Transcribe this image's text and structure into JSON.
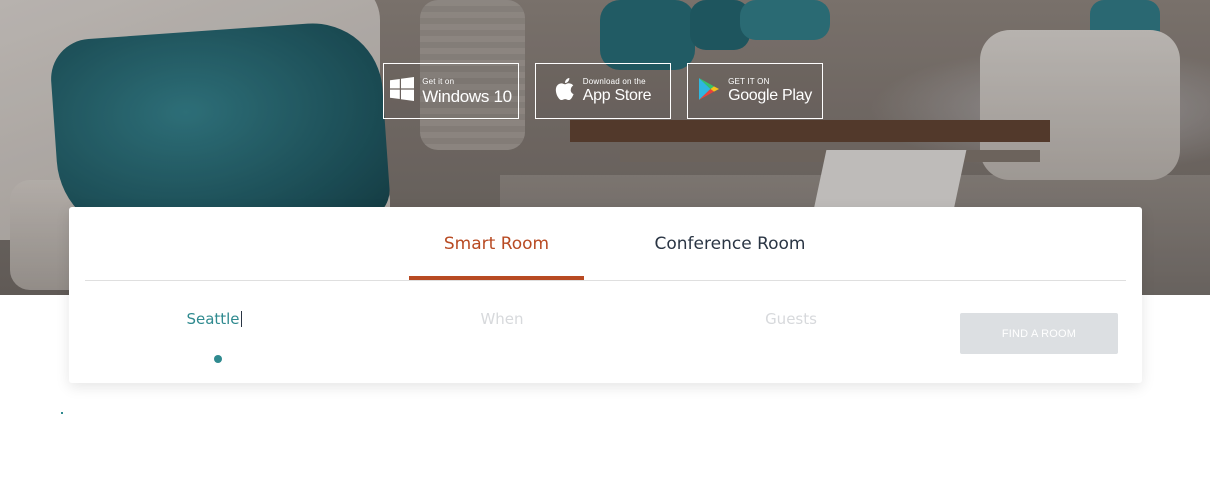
{
  "hero": {
    "image_name": "lounge-background-image"
  },
  "badges": [
    {
      "icon": "windows-icon",
      "small": "Get it on",
      "big": "Windows 10"
    },
    {
      "icon": "apple-icon",
      "small": "Download on the",
      "big": "App Store"
    },
    {
      "icon": "google-play-icon",
      "small": "GET IT ON",
      "big": "Google Play"
    }
  ],
  "tabs": {
    "active": "Smart Room",
    "inactive": "Conference Room"
  },
  "search": {
    "location_value": "Seattle",
    "when_placeholder": "When",
    "guests_placeholder": "Guests",
    "find_button": "FIND A ROOM"
  },
  "colors": {
    "accent": "#b84a22",
    "teal": "#2f8a8f",
    "text_dark": "#2a3544",
    "button_disabled": "#dcdfe2"
  }
}
